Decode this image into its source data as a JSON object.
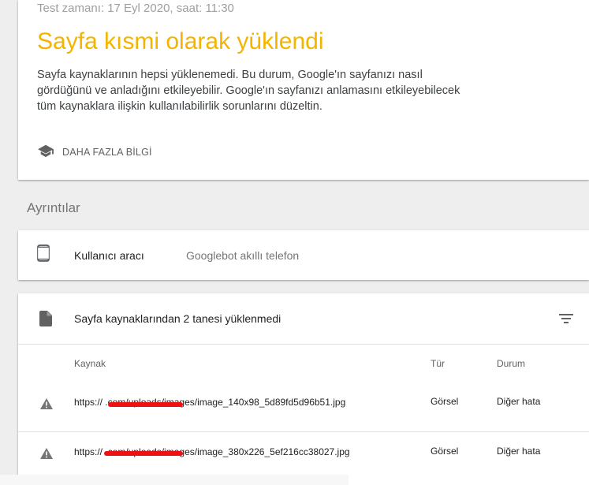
{
  "summary": {
    "test_time": "Test zamanı: 17 Eyl 2020, saat: 11:30",
    "title": "Sayfa kısmi olarak yüklendi",
    "description": "Sayfa kaynaklarının hepsi yüklenemedi. Bu durum, Google'ın sayfanızı nasıl gördüğünü ve anladığını etkileyebilir. Google'ın sayfanızı anlamasını etkileyebilecek tüm kaynaklara ilişkin kullanılabilirlik sorunlarını düzeltin.",
    "learn_more_label": "DAHA FAZLA BİLGİ",
    "title_color": "#f4b400"
  },
  "details": {
    "heading": "Ayrıntılar",
    "user_agent": {
      "label": "Kullanıcı aracı",
      "value": "Googlebot akıllı telefon",
      "icon": "smartphone-icon"
    }
  },
  "resources": {
    "summary": "Sayfa kaynaklarından 2 tanesi yüklenmedi",
    "icon": "file-icon",
    "filter_icon": "filter-icon",
    "columns": {
      "source": "Kaynak",
      "type": "Tür",
      "status": "Durum"
    },
    "rows": [
      {
        "url": "https://                       .com/uploads/images/image_140x98_5d89fd5d96b51.jpg",
        "type": "Görsel",
        "status": "Diğer hata"
      },
      {
        "url": "https://                       .com/uploads/images/image_380x226_5ef216cc38027.jpg",
        "type": "Görsel",
        "status": "Diğer hata"
      }
    ],
    "redaction_color": "#ee1111"
  }
}
